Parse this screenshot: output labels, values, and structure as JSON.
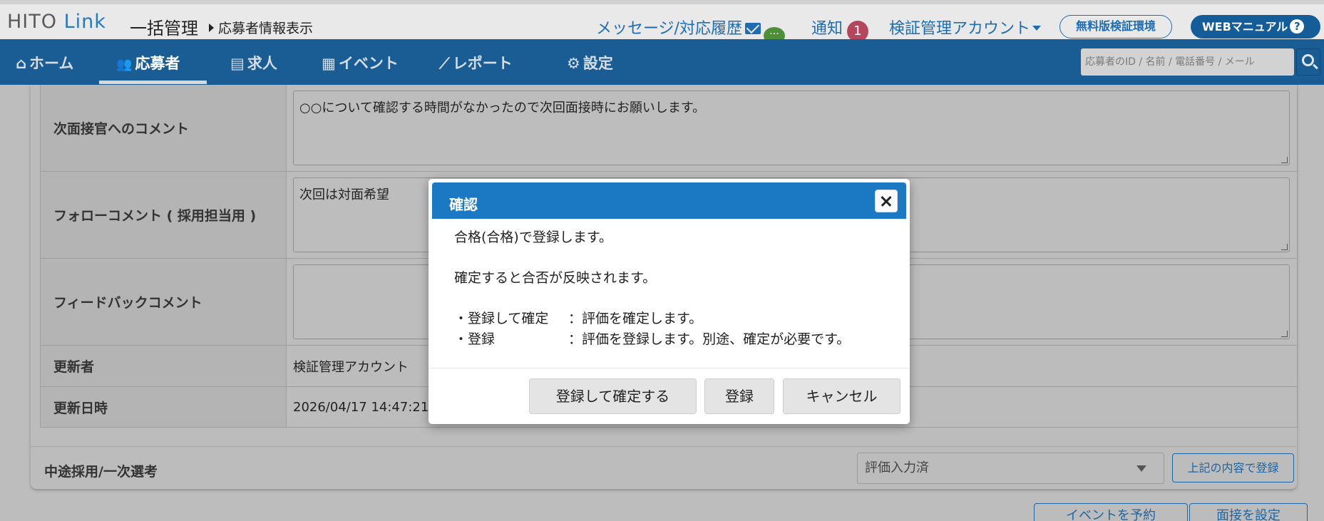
{
  "header": {
    "logo_part1": "HITO",
    "logo_part2": "Link",
    "suite_name": "一括管理",
    "breadcrumb": "応募者情報表示",
    "messages_link": "メッセージ/対応履歴",
    "notifications_label": "通知",
    "notifications_count": "1",
    "account_name": "検証管理アカウント",
    "free_env_button": "無料版検証環境",
    "manual_button": "WEBマニュアル"
  },
  "nav": {
    "items": [
      {
        "label": "ホーム",
        "icon": "home-icon",
        "glyph": "⌂"
      },
      {
        "label": "応募者",
        "icon": "users-icon",
        "glyph": "👥"
      },
      {
        "label": "求人",
        "icon": "clipboard-icon",
        "glyph": "▤"
      },
      {
        "label": "イベント",
        "icon": "calendar-icon",
        "glyph": "▦"
      },
      {
        "label": "レポート",
        "icon": "chart-icon",
        "glyph": "⟋"
      },
      {
        "label": "設定",
        "icon": "gear-icon",
        "glyph": "⚙"
      }
    ],
    "active": "応募者",
    "search_placeholder": "応募者のID / 名前 / 電話番号 / メール"
  },
  "form": {
    "rows": [
      {
        "label": "次面接官へのコメント",
        "value": "○○について確認する時間がなかったので次回面接時にお願いします。"
      },
      {
        "label": "フォローコメント ( 採用担当用 )",
        "value": "次回は対面希望"
      },
      {
        "label": "フィードバックコメント",
        "value": ""
      },
      {
        "label": "更新者",
        "value": "検証管理アカウント"
      },
      {
        "label": "更新日時",
        "value": "2026/04/17 14:47:21"
      }
    ],
    "stage_label": "中途採用/一次選考",
    "stage_status": "評価入力済",
    "register_button": "上記の内容で登録",
    "bottom_buttons": [
      "イベントを予約",
      "面接を設定"
    ]
  },
  "modal": {
    "title": "確認",
    "line1": "合格(合格)で登録します。",
    "line2": "確定すると合否が反映されます。",
    "bullet1_key": "・登録して確定",
    "bullet1_val": "：評価を確定します。",
    "bullet2_key": "・登録",
    "bullet2_val": "：評価を登録します。別途、確定が必要です。",
    "confirm_button": "登録して確定する",
    "register_button": "登録",
    "cancel_button": "キャンセル"
  },
  "colors": {
    "nav_bg": "#1a5d94",
    "modal_header": "#1b78c2",
    "link_blue": "#1f6db0",
    "badge": "#b4475d"
  }
}
